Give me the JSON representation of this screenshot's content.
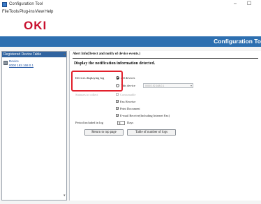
{
  "window": {
    "title": "Configuration Tool",
    "controls": [
      "–",
      "☐"
    ]
  },
  "menubar": [
    "File",
    "Tools",
    "Plug-ins",
    "View",
    "Help"
  ],
  "header": {
    "logo_text": "OKI",
    "banner_title": "Configuration To",
    "brand_color": "#c8102e",
    "band_color": "#2d6fb0"
  },
  "sidebar": {
    "title": "Registered Device Table",
    "device": {
      "name": "Device",
      "address": "0000  192.168.0.1",
      "icon": "printer-icon"
    }
  },
  "main": {
    "breadcrumb": "Alert Info(Detect and notify of device events.)",
    "section_title": "Display the notification information detected.",
    "devices_label": "Devices displaying log",
    "opt_all": "All devices",
    "opt_this": "This device",
    "device_select_value": "0000 192.168.0.1",
    "status_label": "Statuses to collect",
    "check_items": [
      {
        "label": "Consumable",
        "checked": false,
        "disabled": true
      },
      {
        "label": "Fax Receive",
        "checked": true,
        "disabled": false
      },
      {
        "label": "Print Document",
        "checked": true,
        "disabled": false
      },
      {
        "label": "E-mail Receive(Including Internet Fax)",
        "checked": true,
        "disabled": false
      }
    ],
    "period_label": "Period included in log",
    "period_value": "3",
    "period_unit": "Days",
    "btn_return": "Return to top page",
    "btn_table": "Table of number of logs"
  }
}
